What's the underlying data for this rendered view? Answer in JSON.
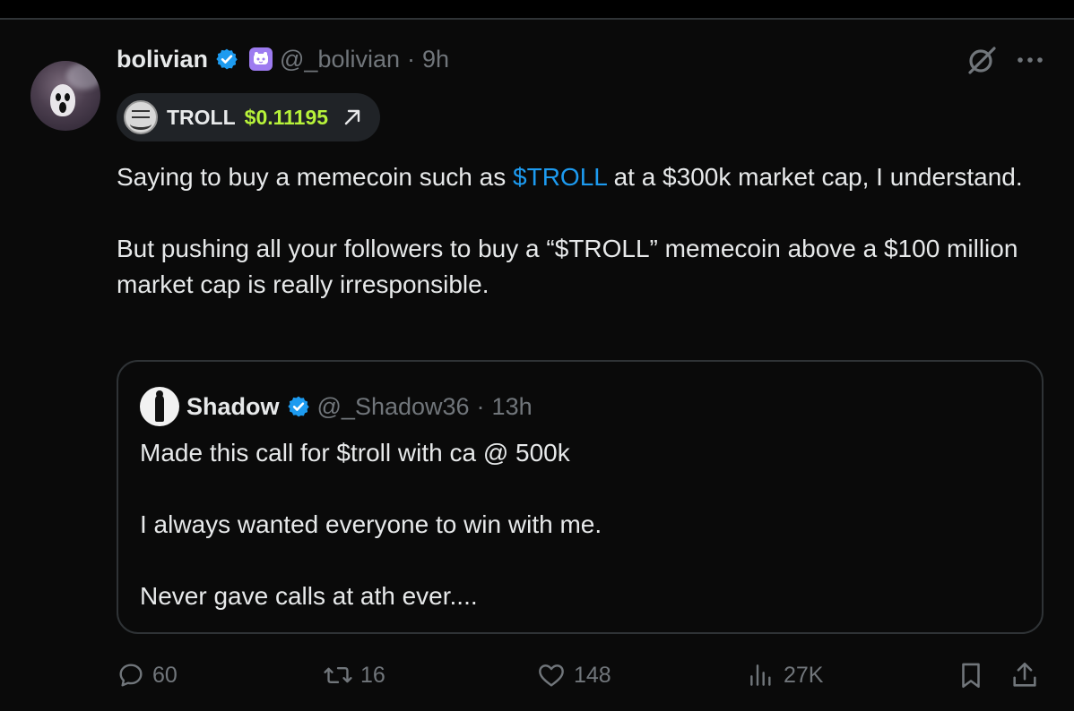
{
  "post": {
    "display_name": "bolivian",
    "handle": "@_bolivian",
    "separator": "·",
    "time": "9h",
    "ticker": {
      "symbol": "TROLL",
      "price": "$0.11195",
      "price_color": "#b7f23a",
      "arrow_icon": "arrow-up-right-icon"
    },
    "text": {
      "p1_before": "Saying to buy a memecoin such as ",
      "p1_cashtag": "$TROLL",
      "p1_after": " at a $300k market cap, I understand.",
      "p2": "But pushing all your followers to buy a “$TROLL” memecoin above a $100 million market cap is really irresponsible."
    }
  },
  "quote": {
    "display_name": "Shadow",
    "handle": "@_Shadow36",
    "separator": "·",
    "time": "13h",
    "lines": [
      "Made this call for $troll with ca @ 500k",
      "I always wanted everyone to win with me.",
      "Never gave calls at ath ever...."
    ]
  },
  "actions": {
    "replies": "60",
    "reposts": "16",
    "likes": "148",
    "views": "27K"
  },
  "colors": {
    "accent": "#1d9bf0",
    "muted": "#71767b",
    "text": "#e7e9ea",
    "bot_badge": "#9d7bf0"
  }
}
